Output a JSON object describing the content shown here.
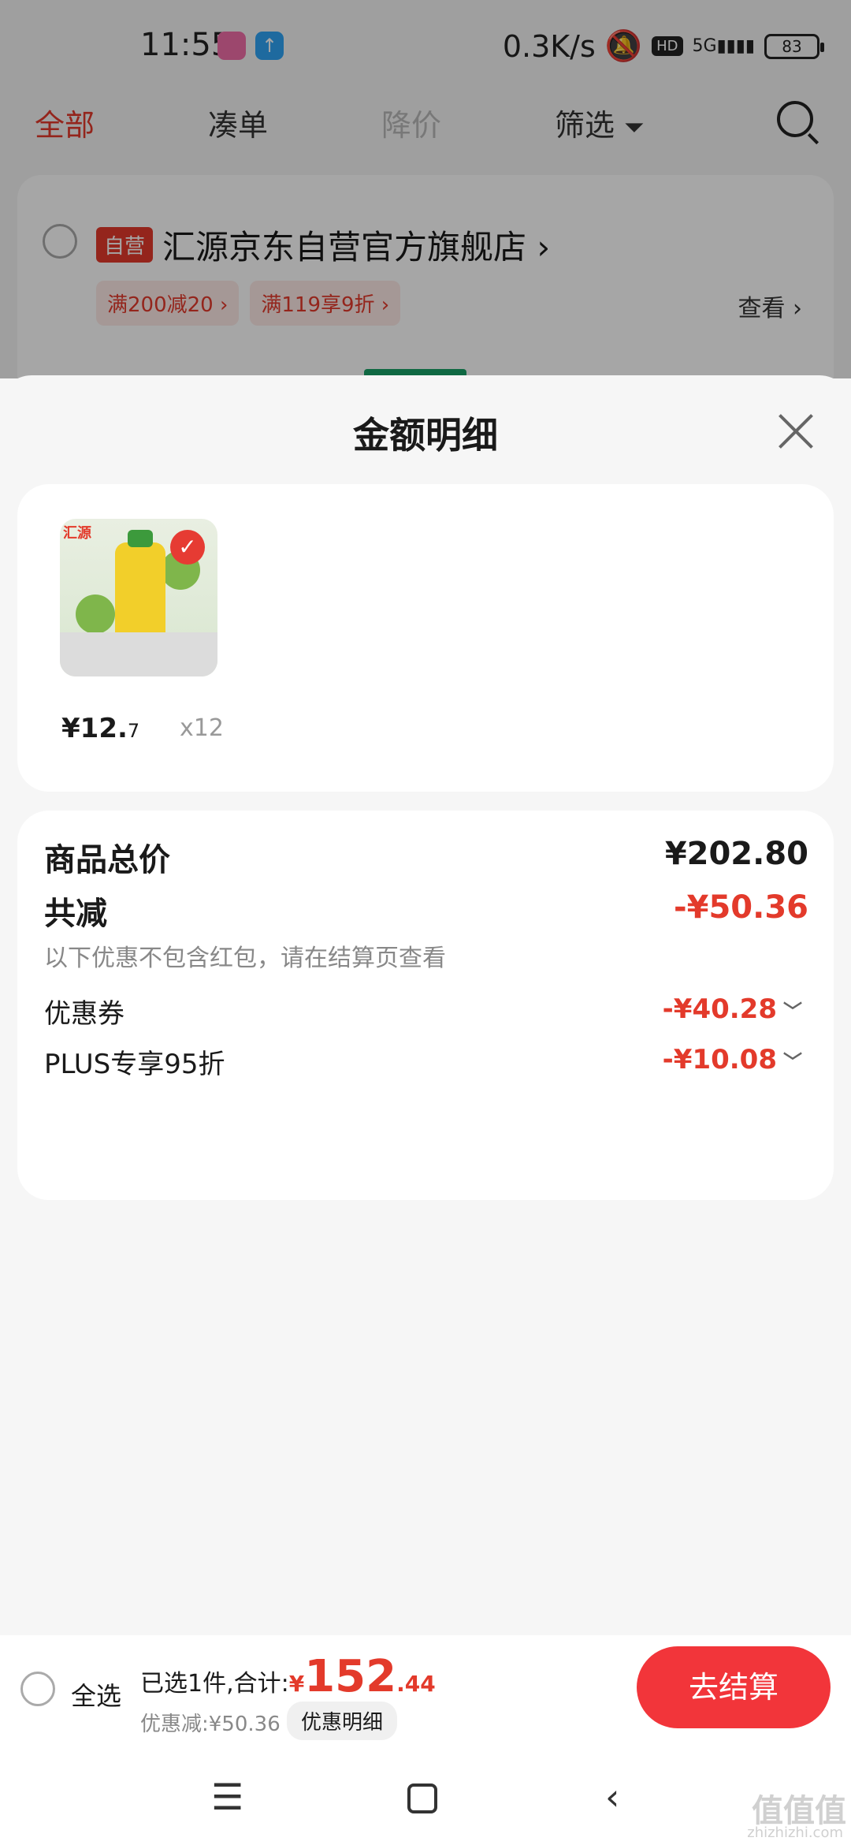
{
  "status_bar": {
    "time": "11:55",
    "network_speed": "0.3K/s",
    "hd": "HD",
    "signal": "5G",
    "battery": "83"
  },
  "top_tabs": [
    {
      "label": "全部",
      "active": true
    },
    {
      "label": "凑单",
      "active": false
    },
    {
      "label": "降价",
      "active": false
    },
    {
      "label": "筛选",
      "active": false
    }
  ],
  "shop": {
    "badge": "自营",
    "name": "汇源京东自营官方旗舰店 ›",
    "promos": [
      "满200减20 ›",
      "满119享9折 ›"
    ],
    "view_label": "查看 ›"
  },
  "sheet": {
    "title": "金额明细",
    "product": {
      "brand": "汇源",
      "price_main": "¥12.",
      "price_decimal": "7",
      "quantity": "x12"
    },
    "summary": {
      "total_label": "商品总价",
      "total_value": "¥202.80",
      "reduce_label": "共减",
      "reduce_value": "-¥50.36",
      "note": "以下优惠不包含红包，请在结算页查看",
      "coupon_label": "优惠券",
      "coupon_value": "-¥40.28",
      "plus_label": "PLUS专享95折",
      "plus_value": "-¥10.08"
    }
  },
  "bottom_bar": {
    "select_all": "全选",
    "selected_text": "已选1件,合计:",
    "currency": "¥",
    "amount_int": "152",
    "amount_dec": ".44",
    "discount_text": "优惠减:¥50.36",
    "detail_chip": "优惠明细",
    "checkout": "去结算"
  },
  "watermark": {
    "text": "值值值",
    "sub": "zhizhizhi.com"
  },
  "colors": {
    "accent_red": "#e33a2b",
    "checkout_red": "#f2353a"
  }
}
